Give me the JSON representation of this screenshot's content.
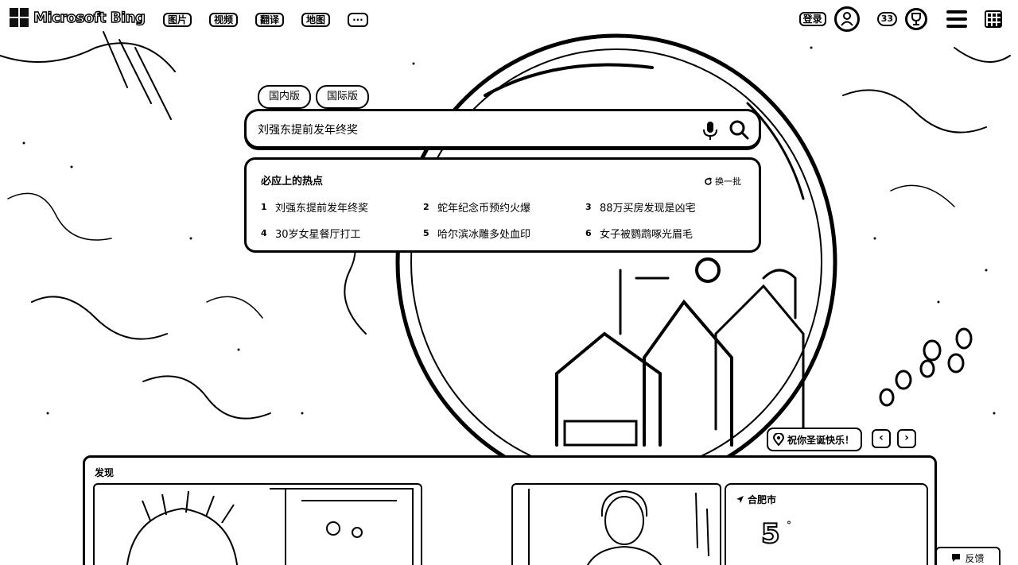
{
  "header": {
    "brand": "Microsoft Bing",
    "nav": [
      "图片",
      "视频",
      "翻译",
      "地图",
      "···"
    ],
    "login_label": "登录",
    "points": "33"
  },
  "search": {
    "tabs": [
      "国内版",
      "国际版"
    ],
    "query": "刘强东提前发年终奖"
  },
  "hot": {
    "title": "必应上的热点",
    "refresh_label": "换一批",
    "items": [
      {
        "num": "1",
        "text": "刘强东提前发年终奖"
      },
      {
        "num": "2",
        "text": "蛇年纪念币预约火爆"
      },
      {
        "num": "3",
        "text": "88万买房发现是凶宅"
      },
      {
        "num": "4",
        "text": "30岁女星餐厅打工"
      },
      {
        "num": "5",
        "text": "哈尔滨冰雕多处血印"
      },
      {
        "num": "6",
        "text": "女子被鹦鹉啄光眉毛"
      }
    ]
  },
  "image_caption": "祝你圣诞快乐！",
  "discover": {
    "title": "发现",
    "weather": {
      "city": "合肥市",
      "temp": "5",
      "unit": "°"
    }
  },
  "feedback_label": "反馈",
  "icons": {
    "logo": "windows-logo-icon",
    "mic": "microphone-icon",
    "search": "search-icon",
    "refresh": "refresh-icon",
    "location": "location-pin-icon",
    "avatar": "user-icon",
    "trophy": "rewards-trophy-icon",
    "menu": "hamburger-icon",
    "apps": "apps-grid-icon",
    "feedback": "feedback-icon"
  }
}
